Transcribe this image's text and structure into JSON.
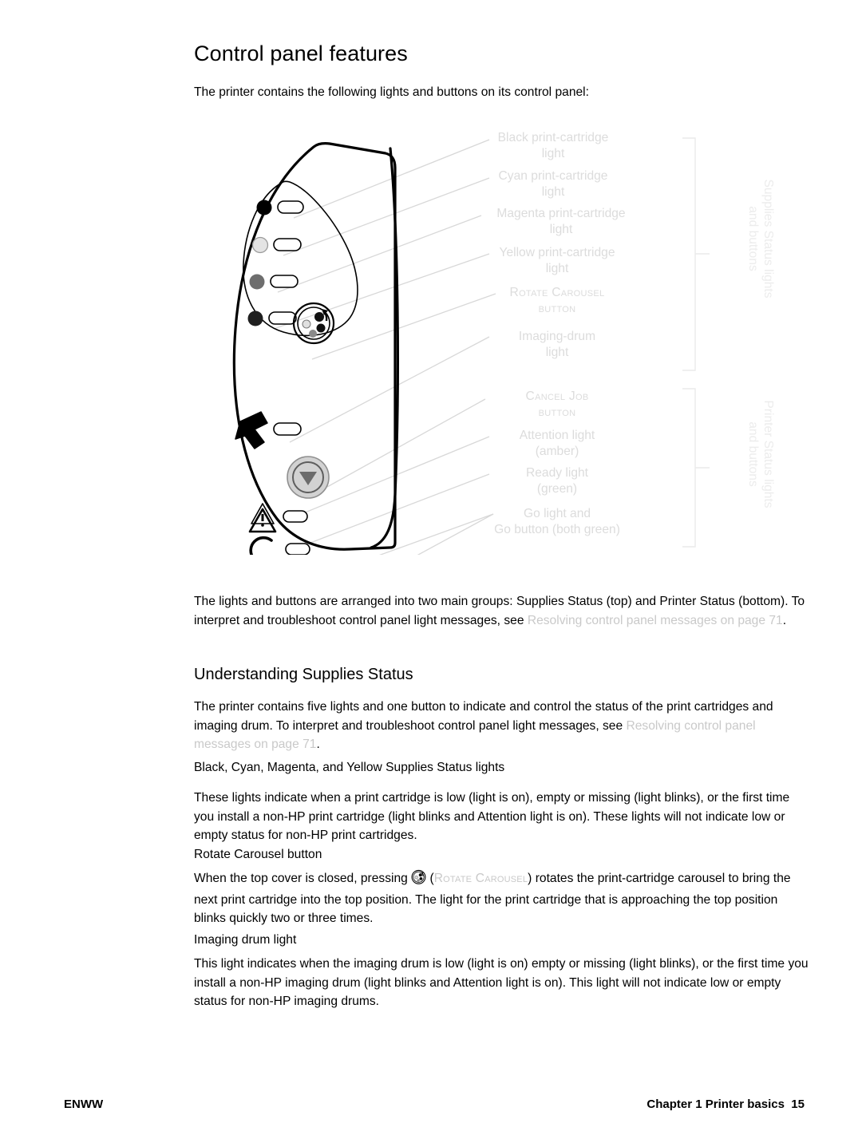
{
  "document": {
    "page_title": "Control panel features",
    "intro": "The printer contains the following lights and buttons on its control panel:"
  },
  "figure": {
    "alt": "HP printer control panel illustration with callout labels",
    "callouts": [
      {
        "id": "black-light",
        "label": "Black print-cartridge\nlight"
      },
      {
        "id": "cyan-light",
        "label": "Cyan print-cartridge\nlight"
      },
      {
        "id": "magenta-light",
        "label": "Magenta print-cartridge\nlight"
      },
      {
        "id": "yellow-light",
        "label": "Yellow print-cartridge\nlight"
      },
      {
        "id": "rotate-carousel",
        "label": "Rotate Carousel\nbutton",
        "smallcaps_first_line": true
      },
      {
        "id": "imaging-drum",
        "label": "Imaging-drum\nlight"
      },
      {
        "id": "cancel-job",
        "label": "Cancel Job\nbutton",
        "smallcaps_first_line": true
      },
      {
        "id": "attention-light",
        "label": "Attention light\n(amber)"
      },
      {
        "id": "ready-light",
        "label": "Ready light\n(green)"
      },
      {
        "id": "go-light",
        "label": "Go light and\nGo button (both green)"
      }
    ],
    "brackets": [
      {
        "id": "supplies-group",
        "label": "Supplies Status lights\nand buttons"
      },
      {
        "id": "printer-group",
        "label": "Printer Status lights\nand buttons"
      }
    ],
    "panel_indicators": {
      "cartridge_dot_colors": [
        "#000000",
        "#e4e4e4",
        "#6e6e6e",
        "#1f1f1f"
      ],
      "button_fill": "#d2d2d2",
      "outline": "#000000",
      "leader_line_color": "#d8d8d8"
    }
  },
  "body": {
    "p_groups_1": "The lights and buttons are arranged into two main groups: Supplies Status (top) and Printer Status (bottom). To interpret and troubleshoot control panel light messages, see ",
    "p_groups_xref": "Resolving control panel messages  on page 71",
    "p_groups_end": ".",
    "h2_understanding": "Understanding Supplies Status",
    "p_five_lights_1": "The printer contains five lights and one button to indicate and control the status of the print cartridges and imaging drum. To interpret and troubleshoot control panel light messages, see",
    "p_five_lights_xref": "Resolving control panel messages  on page 71",
    "p_five_lights_end": ".",
    "subhead_cmyk": "Black, Cyan, Magenta, and Yellow Supplies Status lights",
    "p_cmyk": "These lights indicate when a print cartridge is low (light is on), empty or missing (light blinks), or the first time you install a non-HP print cartridge (light blinks and Attention light is on). These lights will not indicate low or empty status for non-HP print cartridges.",
    "subhead_rotate": "Rotate Carousel button",
    "p_rotate_1": "When the top cover is closed, pressing ",
    "p_rotate_paren_open": " (",
    "p_rotate_sc": "Rotate Carousel",
    "p_rotate_2": ") rotates the print-cartridge carousel to bring the next print cartridge into the top position. The light for the print cartridge that is approaching the top position blinks quickly two or three times.",
    "subhead_imaging": "Imaging drum light",
    "p_imaging": "This light indicates when the imaging drum is low (light is on) empty or missing (light blinks), or the first time you install a non-HP imaging drum (light blinks and Attention light is on). This light will not indicate low or empty status for non-HP imaging drums."
  },
  "footer": {
    "left": "ENWW",
    "right": "Chapter 1 Printer basics  15"
  }
}
